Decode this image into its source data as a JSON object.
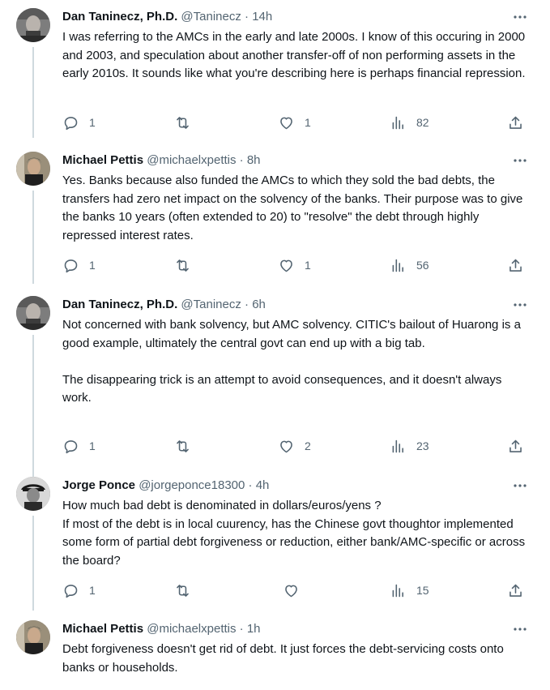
{
  "tweets": [
    {
      "name": "Dan Taninecz, Ph.D.",
      "handle": "@Taninecz",
      "time": "14h",
      "text": "I was referring to the AMCs in the early and late 2000s. I know of this occuring in 2000 and 2003, and speculation about another transfer-off of non performing assets in the early 2010s. It sounds like what you're describing here is perhaps financial repression.",
      "replies": "1",
      "retweets": "",
      "likes": "1",
      "views": "82"
    },
    {
      "name": "Michael Pettis",
      "handle": "@michaelxpettis",
      "time": "8h",
      "text": "Yes. Banks because also funded the AMCs to which they sold the bad debts, the transfers had zero net impact on the solvency of the banks. Their purpose was to give the banks 10 years (often extended to 20) to \"resolve\" the debt through highly repressed interest rates.",
      "replies": "1",
      "retweets": "",
      "likes": "1",
      "views": "56"
    },
    {
      "name": "Dan Taninecz, Ph.D.",
      "handle": "@Taninecz",
      "time": "6h",
      "text": "Not concerned with bank solvency, but AMC solvency. CITIC's bailout of Huarong is a good example, ultimately the central govt can end up with a big tab.\n\nThe disappearing trick is an attempt to avoid consequences, and it doesn't always work.",
      "replies": "1",
      "retweets": "",
      "likes": "2",
      "views": "23"
    },
    {
      "name": "Jorge Ponce",
      "handle": "@jorgeponce18300",
      "time": "4h",
      "text": "How much bad debt is denominated in dollars/euros/yens ?\nIf most of the debt is in local cuurency, has the Chinese govt thoughtor implemented some form of partial debt forgiveness or reduction, either bank/AMC-specific or across the board?",
      "replies": "1",
      "retweets": "",
      "likes": "",
      "views": "15"
    },
    {
      "name": "Michael Pettis",
      "handle": "@michaelxpettis",
      "time": "1h",
      "text": "Debt forgiveness doesn't get rid of debt. It just forces the debt-servicing costs onto banks or households.",
      "replies": "",
      "retweets": "",
      "likes": "",
      "views": ""
    }
  ],
  "separator": "·",
  "icons": {
    "reply": "reply-icon",
    "retweet": "retweet-icon",
    "like": "heart-icon",
    "views": "views-icon",
    "share": "share-icon",
    "more": "more-icon"
  },
  "colors": {
    "text": "#0f1419",
    "secondary": "#536471",
    "thread_line": "#cfd9de"
  }
}
